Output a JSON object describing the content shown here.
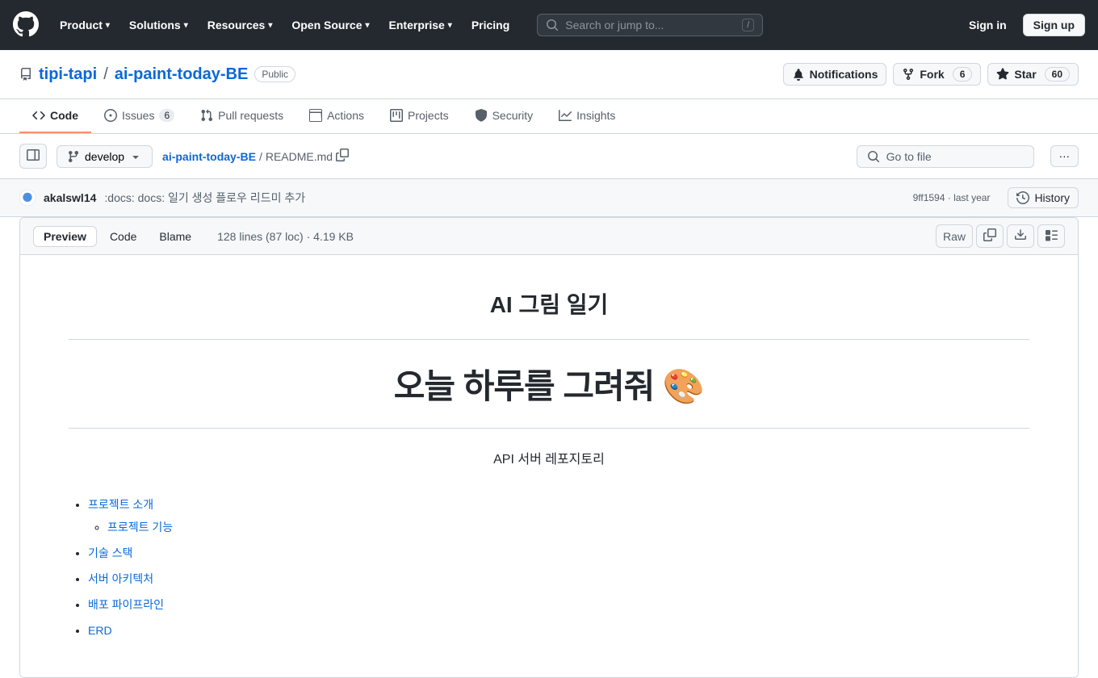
{
  "header": {
    "logo_label": "GitHub",
    "nav_items": [
      {
        "label": "Product",
        "has_chevron": true
      },
      {
        "label": "Solutions",
        "has_chevron": true
      },
      {
        "label": "Resources",
        "has_chevron": true
      },
      {
        "label": "Open Source",
        "has_chevron": true
      },
      {
        "label": "Enterprise",
        "has_chevron": true
      },
      {
        "label": "Pricing",
        "has_chevron": false
      }
    ],
    "search_placeholder": "Search or jump to...",
    "signin_label": "Sign in",
    "signup_label": "Sign up"
  },
  "repo": {
    "owner": "tipi-tapi",
    "name": "ai-paint-today-BE",
    "visibility": "Public",
    "notifications_label": "Notifications",
    "fork_label": "Fork",
    "fork_count": "6",
    "star_label": "Star",
    "star_count": "60"
  },
  "tabs": [
    {
      "label": "Code",
      "icon": "code-icon",
      "badge": null,
      "active": true
    },
    {
      "label": "Issues",
      "icon": "issues-icon",
      "badge": "6",
      "active": false
    },
    {
      "label": "Pull requests",
      "icon": "pr-icon",
      "badge": null,
      "active": false
    },
    {
      "label": "Actions",
      "icon": "actions-icon",
      "badge": null,
      "active": false
    },
    {
      "label": "Projects",
      "icon": "projects-icon",
      "badge": null,
      "active": false
    },
    {
      "label": "Security",
      "icon": "security-icon",
      "badge": null,
      "active": false
    },
    {
      "label": "Insights",
      "icon": "insights-icon",
      "badge": null,
      "active": false
    }
  ],
  "file_nav": {
    "branch": "develop",
    "breadcrumb_repo": "ai-paint-today-BE",
    "breadcrumb_file": "README.md",
    "go_to_file_placeholder": "Go to file",
    "more_options_label": "···"
  },
  "commit": {
    "author": "akalswl14",
    "message": ":docs: docs: 일기 생성 플로우 리드미 추가",
    "hash": "9ff1594",
    "time": "last year",
    "history_label": "History"
  },
  "file_toolbar": {
    "preview_label": "Preview",
    "code_label": "Code",
    "blame_label": "Blame",
    "meta": "128 lines (87 loc) · 4.19 KB",
    "raw_label": "Raw"
  },
  "readme": {
    "title": "AI 그림 일기",
    "subtitle_big": "오늘 하루를 그려줘 🎨",
    "subtitle_small": "API 서버 레포지토리",
    "list_items": [
      {
        "label": "프로젝트 소개",
        "sub": [
          "프로젝트 기능"
        ]
      },
      {
        "label": "기술 스택",
        "sub": []
      },
      {
        "label": "서버 아키텍처",
        "sub": []
      },
      {
        "label": "배포 파이프라인",
        "sub": []
      },
      {
        "label": "ERD",
        "sub": []
      }
    ]
  }
}
